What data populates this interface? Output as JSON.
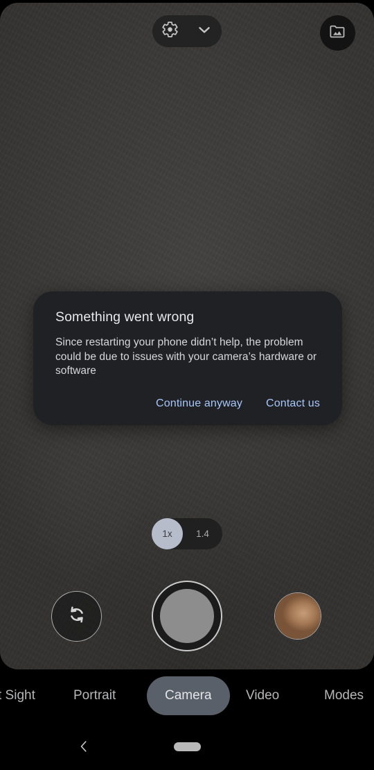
{
  "app": {
    "name": "Camera"
  },
  "topbar": {
    "settings_pill": {
      "gear_icon": "gear-icon",
      "chevron_icon": "chevron-down-icon"
    },
    "gallery_button": {
      "icon": "folder-image-icon",
      "label": "Gallery"
    }
  },
  "dialog": {
    "title": "Something went wrong",
    "body": "Since restarting your phone didn’t help, the problem could be due to issues with your camera’s hardware or software",
    "actions": [
      {
        "label": "Continue anyway",
        "name": "continue-anyway-button"
      },
      {
        "label": "Contact us",
        "name": "contact-us-button"
      }
    ],
    "accent_color": "#a8c7fa",
    "background_color": "#1f2124"
  },
  "zoom_control": {
    "selected": "1x",
    "options": [
      "1x",
      "1.4"
    ],
    "alternate": "1.4"
  },
  "shutter_row": {
    "flip_camera": {
      "icon": "camera-flip-icon",
      "label": "Switch camera"
    },
    "shutter": {
      "label": "Shutter"
    },
    "thumbnail": {
      "label": "Last photo"
    }
  },
  "modes": {
    "items": [
      {
        "label": "t Sight",
        "selected": false
      },
      {
        "label": "Portrait",
        "selected": false
      },
      {
        "label": "Camera",
        "selected": true
      },
      {
        "label": "Video",
        "selected": false
      },
      {
        "label": "Modes",
        "selected": false
      }
    ]
  },
  "navbar": {
    "back_icon": "chevron-left-icon",
    "home_indicator": "home-pill"
  }
}
